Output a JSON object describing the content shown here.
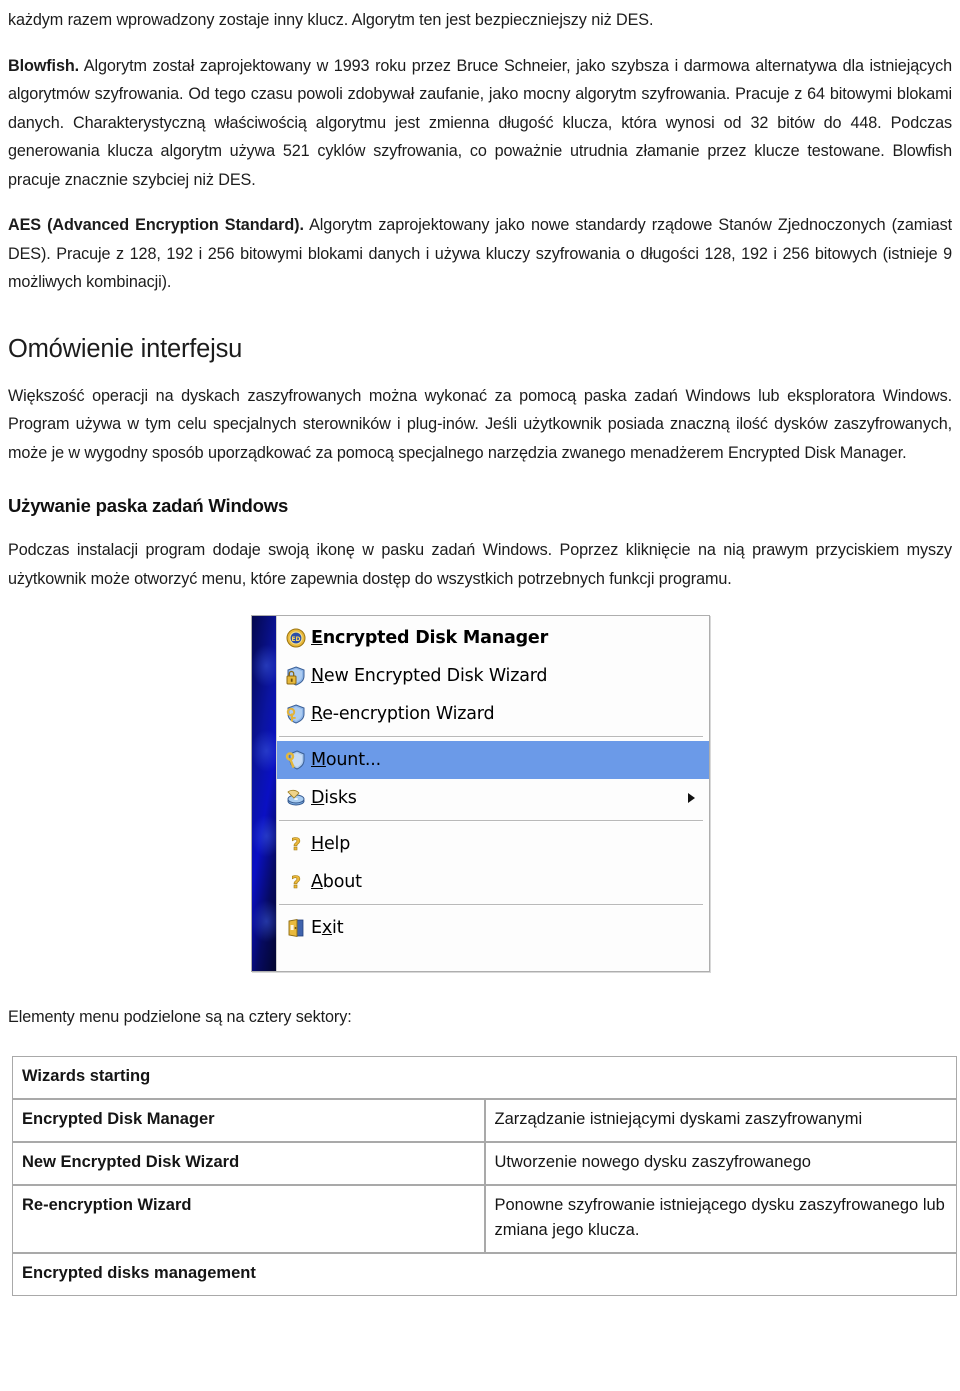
{
  "document": {
    "paragraphs": {
      "p_top": "każdym razem wprowadzony zostaje inny klucz. Algorytm ten jest bezpieczniejszy niż DES.",
      "blowfish_label": "Blowfish.",
      "blowfish_text": " Algorytm został zaprojektowany w 1993 roku przez Bruce Schneier, jako szybsza i darmowa alternatywa dla istniejących algorytmów szyfrowania. Od tego czasu powoli zdobywał zaufanie, jako mocny algorytm szyfrowania. Pracuje z 64 bitowymi blokami danych. Charakterystyczną właściwością algorytmu jest zmienna długość klucza, która wynosi od 32 bitów do 448. Podczas generowania klucza algorytm używa 521 cyklów szyfrowania, co poważnie utrudnia złamanie przez klucze testowane. Blowfish pracuje znacznie szybciej niż DES.",
      "aes_label": "AES (Advanced Encryption Standard).",
      "aes_text": " Algorytm zaprojektowany jako nowe standardy rządowe Stanów Zjednoczonych (zamiast DES). Pracuje z 128, 192 i 256 bitowymi blokami danych i używa kluczy szyfrowania o długości 128, 192 i 256 bitowych (istnieje 9 możliwych kombinacji).",
      "interface_heading": "Omówienie interfejsu",
      "interface_text": "Większość operacji na dyskach zaszyfrowanych można wykonać za pomocą paska zadań Windows lub eksploratora Windows. Program używa w tym celu specjalnych sterowników i plug-inów. Jeśli użytkownik posiada znaczną ilość dysków zaszyfrowanych, może je w wygodny sposób uporządkować za pomocą specjalnego narzędzia zwanego menadżerem Encrypted Disk Manager.",
      "taskbar_heading": "Używanie paska zadań Windows",
      "taskbar_text": "Podczas instalacji program dodaje swoją ikonę w pasku zadań Windows. Poprzez kliknięcie na nią prawym przyciskiem myszy użytkownik może otworzyć menu, które zapewnia dostęp do wszystkich potrzebnych funkcji programu.",
      "sectors_intro": "Elementy menu podzielone są na cztery sektory:"
    }
  },
  "context_menu": {
    "highlight_color": "#6b9ae8",
    "gutter_color": "#0a10c4",
    "items": [
      {
        "id": "encrypted-disk-manager",
        "accel": "E",
        "rest": "ncrypted Disk Manager",
        "icon": "shield-ed-icon",
        "bold": true,
        "selected": false,
        "submenu": false
      },
      {
        "id": "new-encrypted-disk-wizard",
        "accel": "N",
        "rest": "ew Encrypted Disk Wizard",
        "icon": "shield-lock-icon",
        "bold": false,
        "selected": false,
        "submenu": false
      },
      {
        "id": "re-encryption-wizard",
        "accel": "R",
        "rest": "e-encryption Wizard",
        "icon": "shield-key-icon",
        "bold": false,
        "selected": false,
        "submenu": false
      },
      {
        "id": "mount",
        "accel": "M",
        "rest": "ount...",
        "icon": "shield-wrench-icon",
        "bold": false,
        "selected": true,
        "submenu": false
      },
      {
        "id": "disks",
        "accel": "D",
        "rest": "isks",
        "icon": "disk-icon",
        "bold": false,
        "selected": false,
        "submenu": true
      },
      {
        "id": "help",
        "accel": "H",
        "rest": "elp",
        "icon": "question-mark-icon",
        "bold": false,
        "selected": false,
        "submenu": false
      },
      {
        "id": "about",
        "accel": "A",
        "rest": "bout",
        "icon": "question-mark-icon",
        "bold": false,
        "selected": false,
        "submenu": false
      },
      {
        "id": "exit",
        "accel": "x",
        "pre": "E",
        "rest": "it",
        "icon": "exit-door-icon",
        "bold": false,
        "selected": false,
        "submenu": false
      }
    ]
  },
  "sector_table": {
    "rows": [
      {
        "type": "header",
        "label": "Wizards starting"
      },
      {
        "type": "pair",
        "name": "Encrypted Disk Manager",
        "desc": "Zarządzanie istniejącymi dyskami zaszyfrowanymi"
      },
      {
        "type": "pair",
        "name": "New Encrypted Disk Wizard",
        "desc": "Utworzenie nowego dysku zaszyfrowanego"
      },
      {
        "type": "pair",
        "name": "Re-encryption Wizard",
        "desc": "Ponowne szyfrowanie istniejącego dysku zaszyfrowanego lub zmiana jego klucza."
      },
      {
        "type": "header",
        "label": "Encrypted disks management"
      }
    ]
  }
}
